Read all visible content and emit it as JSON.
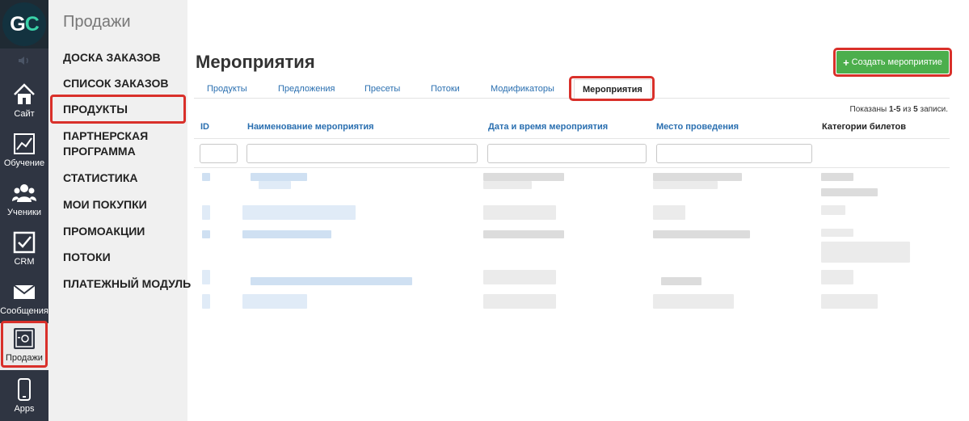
{
  "logo": {
    "part1": "G",
    "part2": "C"
  },
  "rail": {
    "items": [
      {
        "label": "Сайт",
        "icon": "house-icon"
      },
      {
        "label": "Обучение",
        "icon": "chart-line-icon"
      },
      {
        "label": "Ученики",
        "icon": "users-icon"
      },
      {
        "label": "CRM",
        "icon": "checkbox-icon"
      },
      {
        "label": "Сообщения",
        "icon": "envelope-icon"
      },
      {
        "label": "Продажи",
        "icon": "safe-icon"
      },
      {
        "label": "Apps",
        "icon": "phone-icon"
      }
    ],
    "active": "Продажи"
  },
  "subnav": {
    "title": "Продажи",
    "items": [
      {
        "label": "ДОСКА ЗАКАЗОВ"
      },
      {
        "label": "СПИСОК ЗАКАЗОВ"
      },
      {
        "label": "ПРОДУКТЫ"
      },
      {
        "label": "ПАРТНЕРСКАЯ ПРОГРАММА"
      },
      {
        "label": "СТАТИСТИКА"
      },
      {
        "label": "МОИ ПОКУПКИ"
      },
      {
        "label": "ПРОМОАКЦИИ"
      },
      {
        "label": "ПОТОКИ"
      },
      {
        "label": "ПЛАТЕЖНЫЙ МОДУЛЬ"
      }
    ]
  },
  "main": {
    "title": "Мероприятия",
    "create_button": "Создать мероприятие",
    "tabs": [
      {
        "label": "Продукты"
      },
      {
        "label": "Предложения"
      },
      {
        "label": "Пресеты"
      },
      {
        "label": "Потоки"
      },
      {
        "label": "Модификаторы"
      },
      {
        "label": "Мероприятия"
      }
    ],
    "active_tab": "Мероприятия",
    "summary": {
      "prefix": "Показаны ",
      "range": "1-5",
      "middle": " из ",
      "total": "5",
      "suffix": " записи."
    },
    "columns": [
      {
        "label": "ID"
      },
      {
        "label": "Наименование мероприятия"
      },
      {
        "label": "Дата и время мероприятия"
      },
      {
        "label": "Место проведения"
      },
      {
        "label": "Категории билетов"
      }
    ]
  },
  "colors": {
    "rail_bg": "#2f3542",
    "subnav_bg": "#f0f0f0",
    "link": "#2a6fb0",
    "create_button_bg": "#4cae4c",
    "highlight": "#d9302a"
  }
}
